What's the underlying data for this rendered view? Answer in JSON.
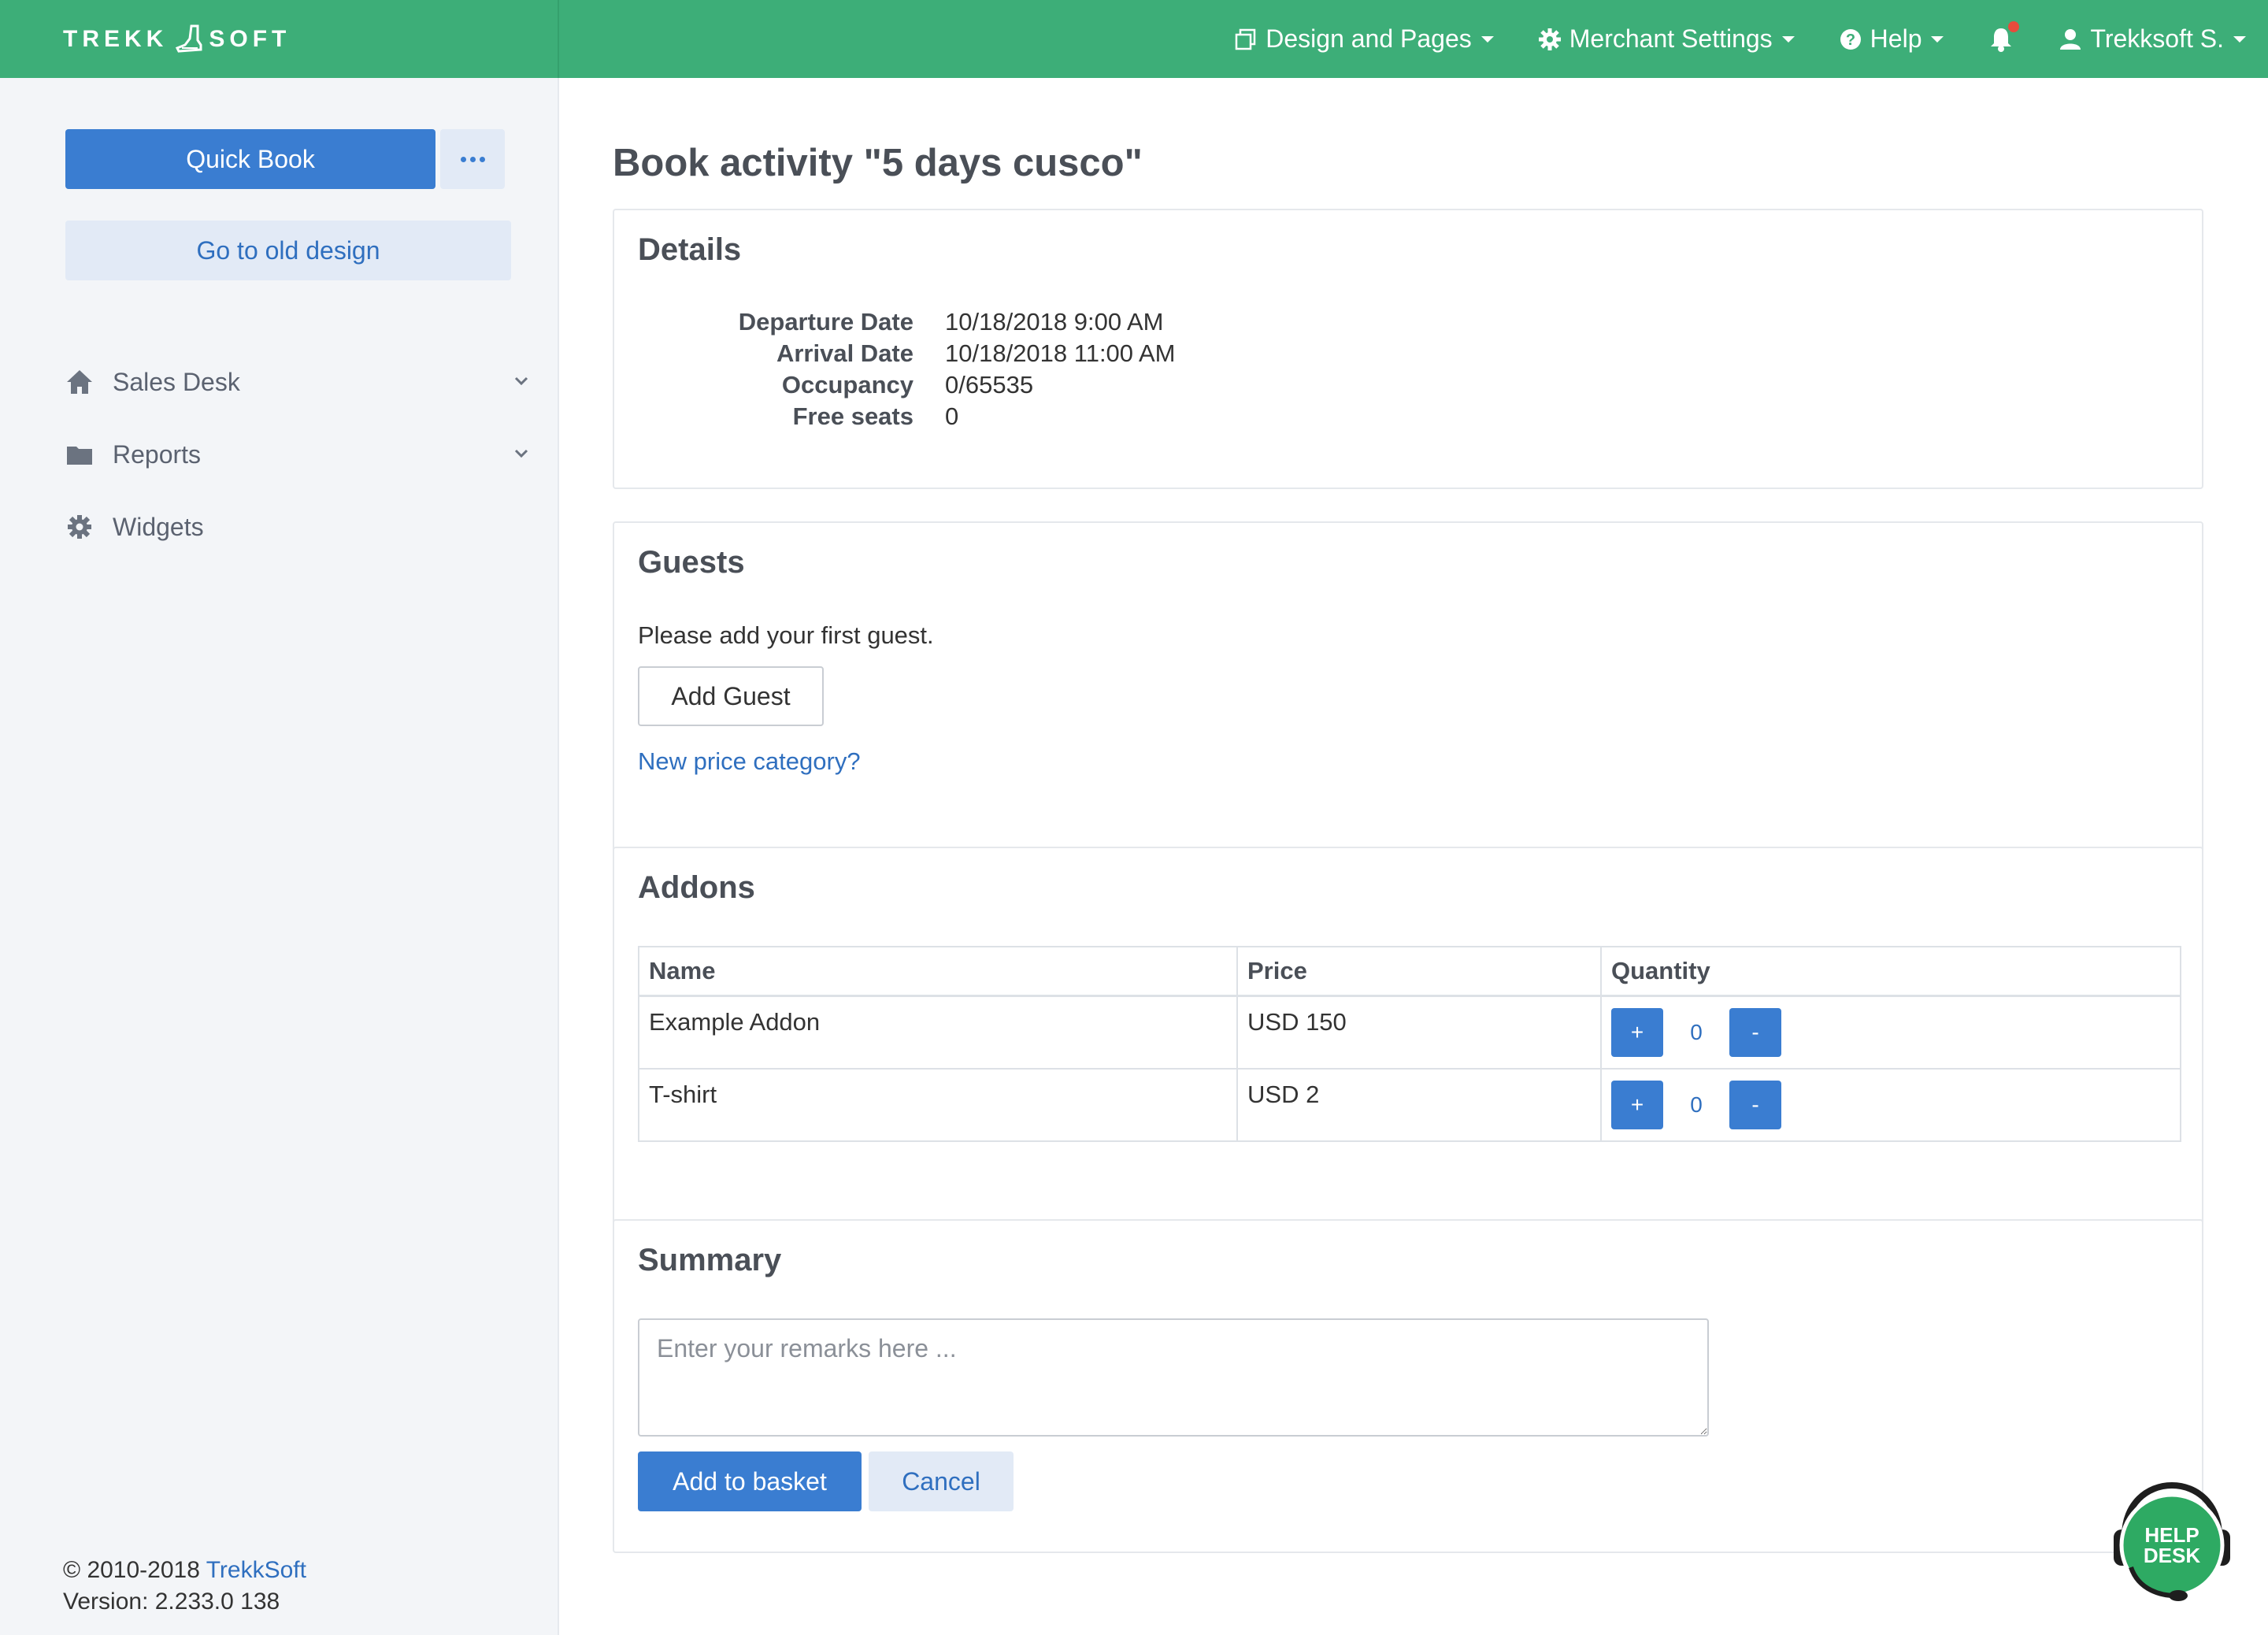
{
  "brand": {
    "left": "TREKK",
    "right": "SOFT"
  },
  "topnav": {
    "design_pages": "Design and Pages",
    "merchant_settings": "Merchant Settings",
    "help": "Help",
    "user": "Trekksoft S."
  },
  "sidebar": {
    "quick_book": "Quick Book",
    "old_design": "Go to old design",
    "items": [
      {
        "label": "Sales Desk",
        "icon": "home-icon",
        "expandable": true
      },
      {
        "label": "Reports",
        "icon": "folder-icon",
        "expandable": true
      },
      {
        "label": "Widgets",
        "icon": "gear-icon",
        "expandable": false
      }
    ],
    "footer": {
      "copyright": "© 2010-2018 ",
      "company_link": "TrekkSoft",
      "version": "Version: 2.233.0 138"
    }
  },
  "page": {
    "title": "Book activity \"5 days cusco\""
  },
  "details": {
    "title": "Details",
    "rows": [
      {
        "label": "Departure Date",
        "value": "10/18/2018 9:00 AM"
      },
      {
        "label": "Arrival Date",
        "value": "10/18/2018 11:00 AM"
      },
      {
        "label": "Occupancy",
        "value": "0/65535"
      },
      {
        "label": "Free seats",
        "value": "0"
      }
    ]
  },
  "guests": {
    "title": "Guests",
    "message": "Please add your first guest.",
    "add_guest": "Add Guest",
    "new_price_category": "New price category?"
  },
  "addons": {
    "title": "Addons",
    "columns": [
      "Name",
      "Price",
      "Quantity"
    ],
    "rows": [
      {
        "name": "Example Addon",
        "price": "USD 150",
        "quantity": "0"
      },
      {
        "name": "T-shirt",
        "price": "USD 2",
        "quantity": "0"
      }
    ],
    "plus_label": "+",
    "minus_label": "-"
  },
  "summary": {
    "title": "Summary",
    "remarks_placeholder": "Enter your remarks here ...",
    "add_to_basket": "Add to basket",
    "cancel": "Cancel"
  },
  "helpdesk": {
    "line1": "HELP",
    "line2": "DESK"
  },
  "colors": {
    "topbar": "#3dae78",
    "primary": "#3a7dd1",
    "sidebar_bg": "#f3f5f8",
    "notification_dot": "#e74c3c"
  }
}
